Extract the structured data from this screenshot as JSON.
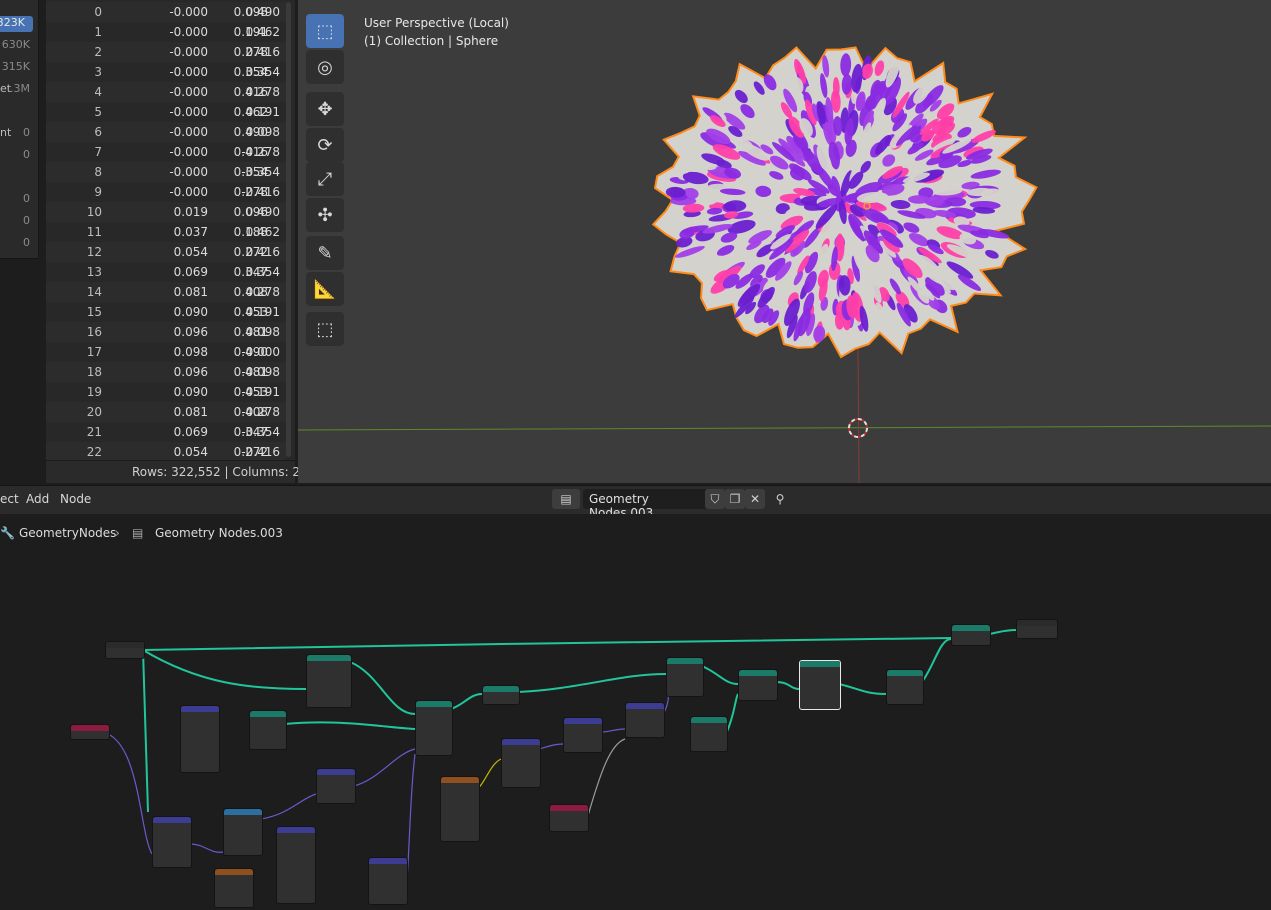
{
  "stats": {
    "items": [
      {
        "label": "",
        "value": "323K",
        "active": true
      },
      {
        "label": "",
        "value": "630K",
        "active": false
      },
      {
        "label": "",
        "value": "315K",
        "active": false
      },
      {
        "label": "et",
        "value": ".3M",
        "active": false
      },
      {
        "label": "nt",
        "value": "0",
        "active": false
      },
      {
        "label": "",
        "value": "0",
        "active": false
      },
      {
        "label": "",
        "value": "0",
        "active": false
      },
      {
        "label": "",
        "value": "0",
        "active": false
      },
      {
        "label": "",
        "value": "0",
        "active": false
      }
    ]
  },
  "spreadsheet": {
    "rows": [
      [
        "0",
        "-0.000",
        "0.098",
        "0.490"
      ],
      [
        "1",
        "-0.000",
        "0.191",
        "0.462"
      ],
      [
        "2",
        "-0.000",
        "0.278",
        "0.416"
      ],
      [
        "3",
        "-0.000",
        "0.354",
        "0.354"
      ],
      [
        "4",
        "-0.000",
        "0.416",
        "0.278"
      ],
      [
        "5",
        "-0.000",
        "0.462",
        "0.191"
      ],
      [
        "6",
        "-0.000",
        "0.490",
        "0.098"
      ],
      [
        "7",
        "-0.000",
        "0.416",
        "-0.278"
      ],
      [
        "8",
        "-0.000",
        "0.354",
        "-0.354"
      ],
      [
        "9",
        "-0.000",
        "0.278",
        "-0.416"
      ],
      [
        "10",
        "0.019",
        "0.096",
        "0.490"
      ],
      [
        "11",
        "0.037",
        "0.188",
        "0.462"
      ],
      [
        "12",
        "0.054",
        "0.272",
        "0.416"
      ],
      [
        "13",
        "0.069",
        "0.347",
        "0.354"
      ],
      [
        "14",
        "0.081",
        "0.408",
        "0.278"
      ],
      [
        "15",
        "0.090",
        "0.453",
        "0.191"
      ],
      [
        "16",
        "0.096",
        "0.481",
        "0.098"
      ],
      [
        "17",
        "0.098",
        "0.490",
        "-0.000"
      ],
      [
        "18",
        "0.096",
        "0.481",
        "-0.098"
      ],
      [
        "19",
        "0.090",
        "0.453",
        "-0.191"
      ],
      [
        "20",
        "0.081",
        "0.408",
        "-0.278"
      ],
      [
        "21",
        "0.069",
        "0.347",
        "-0.354"
      ],
      [
        "22",
        "0.054",
        "0.272",
        "-0.416"
      ]
    ],
    "footer": "Rows: 322,552   |   Columns: 2"
  },
  "viewport": {
    "line1": "User Perspective (Local)",
    "line2": "(1) Collection | Sphere",
    "tools": [
      "select-box-icon",
      "cursor-icon",
      "move-icon",
      "rotate-icon",
      "scale-icon",
      "transform-icon",
      "annotate-icon",
      "measure-icon",
      "add-cube-icon"
    ],
    "colors": {
      "fur_purple": "#8a2be2",
      "fur_pink": "#ff3fa8",
      "fur_white": "#d4d2cc",
      "outline": "#ff8c1a",
      "bg": "#3c3c3c",
      "grid_x": "#8a3a3a",
      "grid_y": "#5e8a2a"
    }
  },
  "node_editor": {
    "menu": [
      "ect",
      "Add",
      "Node"
    ],
    "tree_name": "Geometry Nodes.003",
    "breadcrumb": {
      "root": "GeometryNodes",
      "child": "Geometry Nodes.003"
    },
    "header_colors": {
      "geometry": "#1b7b68",
      "input": "#8b1b3f",
      "vector": "#3c3c93",
      "math": "#2d6ea0",
      "texture": "#8f4f1e",
      "output": "#2b2b2b"
    }
  }
}
